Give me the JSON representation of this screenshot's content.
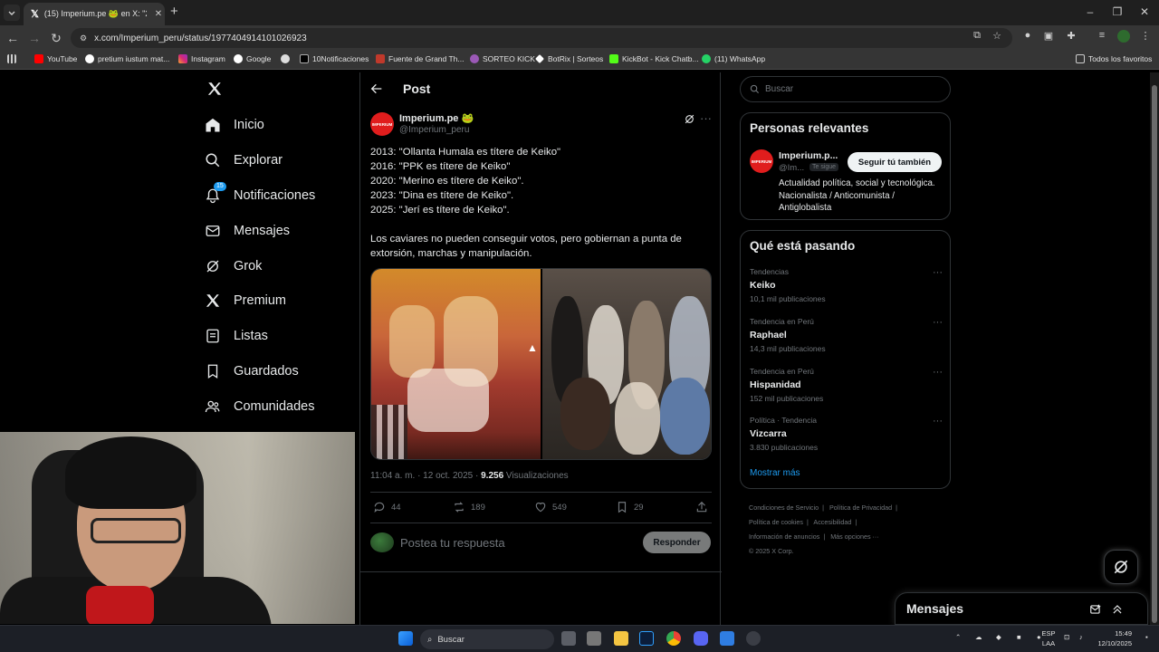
{
  "browser": {
    "tab_title": "(15) Imperium.pe 🐸 en X: \"2013",
    "url": "x.com/Imperium_peru/status/1977404914101026923",
    "bookmarks": [
      "YouTube",
      "pretium iustum mat...",
      "Instagram",
      "Google",
      "",
      "10Notificaciones",
      "Fuente de Grand Th...",
      "SORTEO KICK",
      "BotRix | Sorteos",
      "KickBot - Kick Chatb...",
      "(11) WhatsApp"
    ],
    "all_bookmarks": "Todos los favoritos"
  },
  "nav": {
    "items": [
      {
        "label": "Inicio",
        "icon": "home-icon"
      },
      {
        "label": "Explorar",
        "icon": "search-icon"
      },
      {
        "label": "Notificaciones",
        "icon": "bell-icon"
      },
      {
        "label": "Mensajes",
        "icon": "mail-icon"
      },
      {
        "label": "Grok",
        "icon": "grok-icon"
      },
      {
        "label": "Premium",
        "icon": "x-premium-icon"
      },
      {
        "label": "Listas",
        "icon": "list-icon"
      },
      {
        "label": "Guardados",
        "icon": "bookmark-icon"
      },
      {
        "label": "Comunidades",
        "icon": "communities-icon"
      }
    ],
    "notif_count": "15"
  },
  "post": {
    "header_title": "Post",
    "avatar_text": "IMPERIUM",
    "author_name": "Imperium.pe 🐸",
    "author_handle": "@Imperium_peru",
    "text": "2013: \"Ollanta Humala es títere de Keiko\"\n2016: \"PPK es títere de Keiko\"\n2020: \"Merino es títere de Keiko\".\n2023: \"Dina es títere de Keiko\".\n2025: \"Jerí es títere de Keiko\".\n\nLos caviares no pueden conseguir votos, pero gobiernan a punta de extorsión, marchas y manipulación.",
    "time": "11:04 a. m. · 12 oct. 2025 ·",
    "views_count": "9.256",
    "views_label": "Visualizaciones",
    "replies": "44",
    "reposts": "189",
    "likes": "549",
    "bookmarks": "29",
    "reply_placeholder": "Postea tu respuesta",
    "reply_button": "Responder"
  },
  "sidebar": {
    "search_placeholder": "Buscar",
    "relevant_title": "Personas relevantes",
    "relevant": {
      "avatar_text": "IMPERIUM",
      "name": "Imperium.p...",
      "handle": "@Im...",
      "follows_you": "Te sigue",
      "follow_button": "Seguir tú también",
      "bio": "Actualidad política, social y tecnológica. Nacionalista / Anticomunista / Antiglobalista"
    },
    "trends_title": "Qué está pasando",
    "trends": [
      {
        "context": "Tendencias",
        "name": "Keiko",
        "count": "10,1 mil publicaciones"
      },
      {
        "context": "Tendencia en Perú",
        "name": "Raphael",
        "count": "14,3 mil publicaciones"
      },
      {
        "context": "Tendencia en Perú",
        "name": "Hispanidad",
        "count": "152 mil publicaciones"
      },
      {
        "context": "Política · Tendencia",
        "name": "Vizcarra",
        "count": "3.830 publicaciones"
      }
    ],
    "show_more": "Mostrar más",
    "footer": [
      "Condiciones de Servicio",
      "|",
      "Política de Privacidad",
      "|",
      "Política de cookies",
      "|",
      "Accesibilidad",
      "|",
      "Información de anuncios",
      "|",
      "Más opciones ···",
      "© 2025 X Corp."
    ]
  },
  "messages_dock": {
    "title": "Mensajes"
  },
  "taskbar": {
    "search": "Buscar",
    "lang": "ESP",
    "lang2": "LAA",
    "time": "15:49",
    "date": "12/10/2025"
  }
}
